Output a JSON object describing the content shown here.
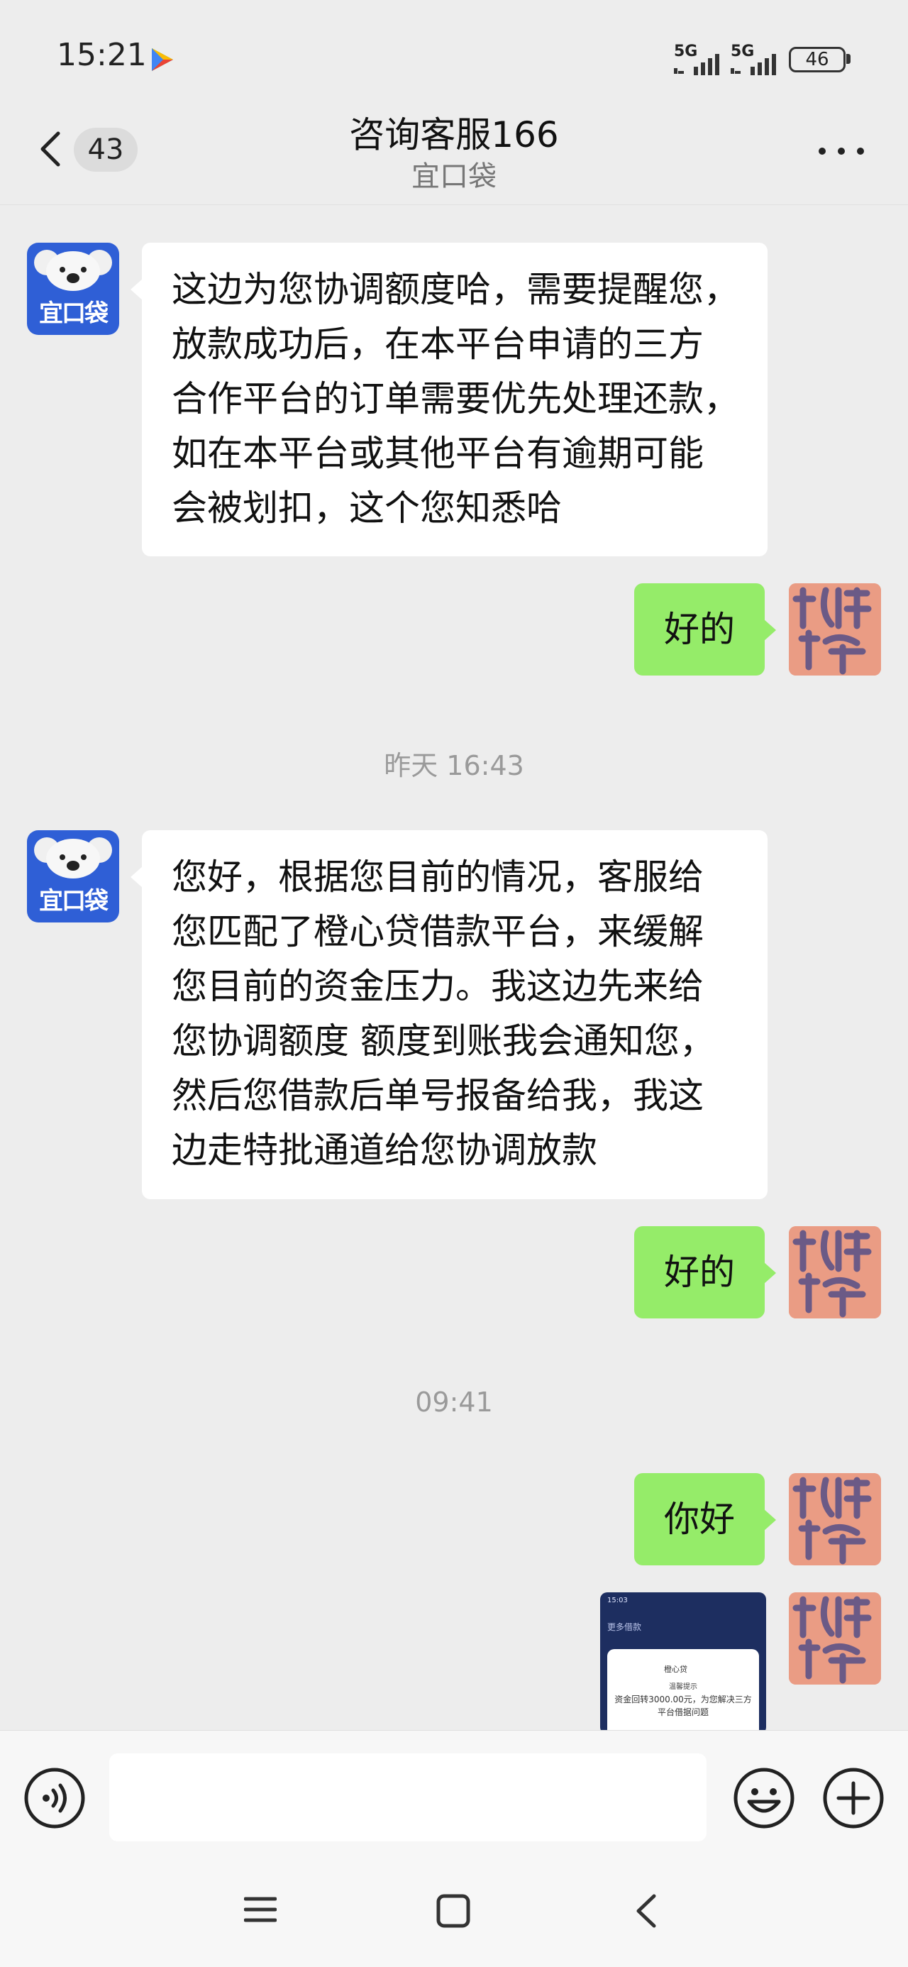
{
  "status_bar": {
    "time": "15:21",
    "network1": "5G",
    "network2": "5G",
    "battery": "46",
    "play_icon": "play-store-icon"
  },
  "header": {
    "unread_count": "43",
    "title": "咨询客服166",
    "subtitle": "宜口袋",
    "back_icon": "chevron-left-icon",
    "more_icon": "more-dots-icon"
  },
  "bot_avatar_label": "宜口袋",
  "messages": [
    {
      "from": "agent",
      "text": "这边为您协调额度哈，需要提醒您，\n放款成功后，在本平台申请的三方\n合作平台的订单需要优先处理还款，\n如在本平台或其他平台有逾期可能\n会被划扣，这个您知悉哈"
    },
    {
      "from": "user",
      "text": "好的"
    },
    {
      "type": "timestamp",
      "text": "昨天 16:43"
    },
    {
      "from": "agent",
      "text": "您好，根据您目前的情况，客服给\n您匹配了橙心贷借款平台，来缓解\n您目前的资金压力。我这边先来给\n您协调额度 额度到账我会通知您，\n然后您借款后单号报备给我，我这\n边走特批通道给您协调放款"
    },
    {
      "from": "user",
      "text": "好的"
    },
    {
      "type": "timestamp",
      "text": "09:41"
    },
    {
      "from": "user",
      "text": "你好"
    },
    {
      "from": "user",
      "type": "image",
      "image": {
        "top_time": "15:03",
        "hint": "更多借款",
        "brand": "橙心贷",
        "title": "温馨提示",
        "body": "资金回转3000.00元，为您解决三方平台借据问题"
      }
    }
  ],
  "input_bar": {
    "placeholder": "",
    "voice_icon": "voice-icon",
    "emoji_icon": "emoji-icon",
    "plus_icon": "plus-icon"
  },
  "system_nav": {
    "menu_icon": "menu-icon",
    "home_icon": "home-icon",
    "back_icon": "back-icon"
  }
}
